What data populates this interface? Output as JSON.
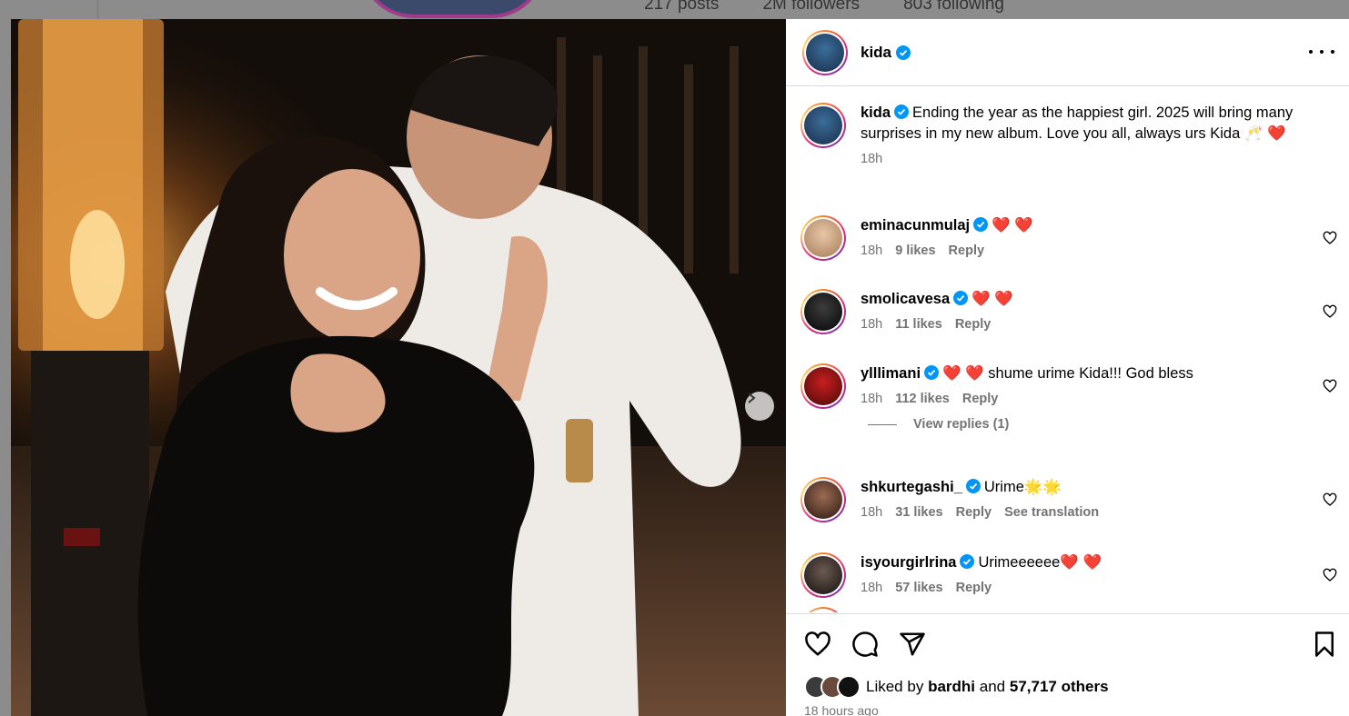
{
  "profile_bg": {
    "posts": "217 posts",
    "followers": "2M followers",
    "following": "803 following"
  },
  "post": {
    "author": "kida",
    "caption": "Ending the year as the happiest girl. 2025 will bring many surprises in my new album. Love you all, always urs Kida 🥂 ❤️",
    "caption_time": "18h"
  },
  "comments": [
    {
      "user": "eminacunmulaj",
      "text": "❤️ ❤️",
      "time": "18h",
      "likes": "9 likes",
      "reply": "Reply",
      "translate": ""
    },
    {
      "user": "smolicavesa",
      "text": "❤️ ❤️",
      "time": "18h",
      "likes": "11 likes",
      "reply": "Reply",
      "translate": ""
    },
    {
      "user": "ylllimani",
      "text": "❤️ ❤️ shume urime Kida!!! God bless",
      "time": "18h",
      "likes": "112 likes",
      "reply": "Reply",
      "translate": ""
    },
    {
      "user": "shkurtegashi_",
      "text": "Urime🌟🌟",
      "time": "18h",
      "likes": "31 likes",
      "reply": "Reply",
      "translate": "See translation"
    },
    {
      "user": "isyourgirlrina",
      "text": "Urimeeeeee❤️ ❤️",
      "time": "18h",
      "likes": "57 likes",
      "reply": "Reply",
      "translate": ""
    }
  ],
  "view_replies": "View replies (1)",
  "likes": {
    "prefix": "Liked by",
    "user": "bardhi",
    "and": "and",
    "others": "57,717 others"
  },
  "time_ago": "18 hours ago",
  "colors": {
    "verified": "#0095f6",
    "meta": "#737373",
    "divider": "#dbdbdb"
  },
  "icons": [
    "more-icon",
    "heart-icon",
    "comment-icon",
    "share-icon",
    "save-icon",
    "verified-icon",
    "chevron-right-icon"
  ]
}
